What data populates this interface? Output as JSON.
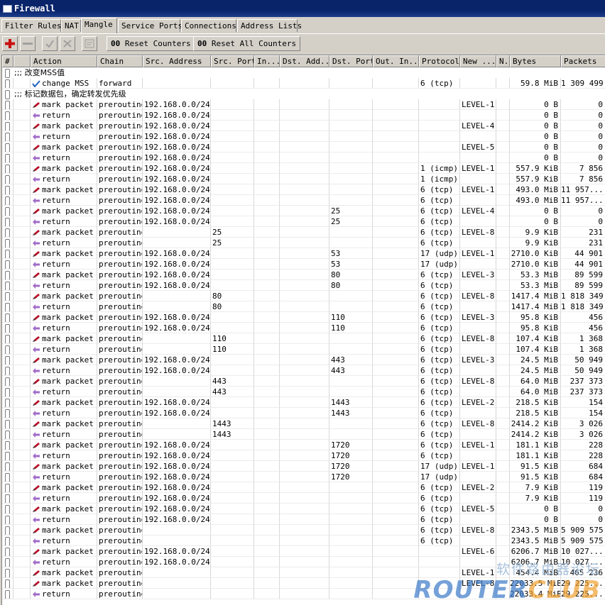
{
  "window": {
    "title": "Firewall"
  },
  "tabs": [
    {
      "label": "Filter Rules",
      "active": false
    },
    {
      "label": "NAT",
      "active": false
    },
    {
      "label": "Mangle",
      "active": true
    },
    {
      "label": "Service Ports",
      "active": false
    },
    {
      "label": "Connections",
      "active": false
    },
    {
      "label": "Address Lists",
      "active": false
    }
  ],
  "toolbar": {
    "reset_counters": "Reset Counters",
    "reset_all_counters": "Reset All Counters",
    "counter_prefix": "00",
    "filter_value": "static",
    "add_icon": "plus-icon",
    "remove_icon": "minus-icon",
    "enable_icon": "check-icon",
    "disable_icon": "x-icon",
    "comment_icon": "note-icon"
  },
  "columns": [
    "#",
    "",
    "Action",
    "Chain",
    "Src. Address",
    "Src. Port",
    "In...",
    "Dst. Add...",
    "Dst. Port",
    "Out. In...",
    "Protocol",
    "New ...",
    "N..",
    "Bytes",
    "Packets"
  ],
  "colors": {
    "selection": "#0a246a",
    "mark_icon": "#b8102a",
    "return_icon": "#a06cc8",
    "check_icon": "#2060c0"
  },
  "rows": [
    {
      "comment": ";;; 改变MSS值"
    },
    {
      "action": "change MSS",
      "icon": "check",
      "chain": "forward",
      "src": "",
      "sport": "",
      "dport": "",
      "proto": "6 (tcp)",
      "mark": "",
      "bytes": "59.8 MiB",
      "packets": "1 309 499"
    },
    {
      "comment": ";;; 标记数据包，确定转发优先级"
    },
    {
      "action": "mark packet",
      "icon": "mark",
      "chain": "prerouting",
      "src": "192.168.0.0/24",
      "sport": "",
      "dport": "",
      "proto": "",
      "mark": "LEVEL-1",
      "bytes": "0 B",
      "packets": "0"
    },
    {
      "action": "return",
      "icon": "return",
      "chain": "prerouting",
      "src": "192.168.0.0/24",
      "sport": "",
      "dport": "",
      "proto": "",
      "mark": "",
      "bytes": "0 B",
      "packets": "0"
    },
    {
      "action": "mark packet",
      "icon": "mark",
      "chain": "prerouting",
      "src": "192.168.0.0/24",
      "sport": "",
      "dport": "",
      "proto": "",
      "mark": "LEVEL-4",
      "bytes": "0 B",
      "packets": "0"
    },
    {
      "action": "return",
      "icon": "return",
      "chain": "prerouting",
      "src": "192.168.0.0/24",
      "sport": "",
      "dport": "",
      "proto": "",
      "mark": "",
      "bytes": "0 B",
      "packets": "0"
    },
    {
      "action": "mark packet",
      "icon": "mark",
      "chain": "prerouting",
      "src": "192.168.0.0/24",
      "sport": "",
      "dport": "",
      "proto": "",
      "mark": "LEVEL-5",
      "bytes": "0 B",
      "packets": "0"
    },
    {
      "action": "return",
      "icon": "return",
      "chain": "prerouting",
      "src": "192.168.0.0/24",
      "sport": "",
      "dport": "",
      "proto": "",
      "mark": "",
      "bytes": "0 B",
      "packets": "0"
    },
    {
      "action": "mark packet",
      "icon": "mark",
      "chain": "prerouting",
      "src": "192.168.0.0/24",
      "sport": "",
      "dport": "",
      "proto": "1 (icmp)",
      "mark": "LEVEL-1",
      "bytes": "557.9 KiB",
      "packets": "7 856"
    },
    {
      "action": "return",
      "icon": "return",
      "chain": "prerouting",
      "src": "192.168.0.0/24",
      "sport": "",
      "dport": "",
      "proto": "1 (icmp)",
      "mark": "",
      "bytes": "557.9 KiB",
      "packets": "7 856"
    },
    {
      "action": "mark packet",
      "icon": "mark",
      "chain": "prerouting",
      "src": "192.168.0.0/24",
      "sport": "",
      "dport": "",
      "proto": "6 (tcp)",
      "mark": "LEVEL-1",
      "bytes": "493.0 MiB",
      "packets": "11 957..."
    },
    {
      "action": "return",
      "icon": "return",
      "chain": "prerouting",
      "src": "192.168.0.0/24",
      "sport": "",
      "dport": "",
      "proto": "6 (tcp)",
      "mark": "",
      "bytes": "493.0 MiB",
      "packets": "11 957..."
    },
    {
      "action": "mark packet",
      "icon": "mark",
      "chain": "prerouting",
      "src": "192.168.0.0/24",
      "sport": "",
      "dport": "25",
      "proto": "6 (tcp)",
      "mark": "LEVEL-4",
      "bytes": "0 B",
      "packets": "0"
    },
    {
      "action": "return",
      "icon": "return",
      "chain": "prerouting",
      "src": "192.168.0.0/24",
      "sport": "",
      "dport": "25",
      "proto": "6 (tcp)",
      "mark": "",
      "bytes": "0 B",
      "packets": "0"
    },
    {
      "action": "mark packet",
      "icon": "mark",
      "chain": "prerouting",
      "src": "",
      "sport": "25",
      "dport": "",
      "proto": "6 (tcp)",
      "mark": "LEVEL-8",
      "bytes": "9.9 KiB",
      "packets": "231"
    },
    {
      "action": "return",
      "icon": "return",
      "chain": "prerouting",
      "src": "",
      "sport": "25",
      "dport": "",
      "proto": "6 (tcp)",
      "mark": "",
      "bytes": "9.9 KiB",
      "packets": "231"
    },
    {
      "action": "mark packet",
      "icon": "mark",
      "chain": "prerouting",
      "src": "192.168.0.0/24",
      "sport": "",
      "dport": "53",
      "proto": "17 (udp)",
      "mark": "LEVEL-1",
      "bytes": "2710.0 KiB",
      "packets": "44 901"
    },
    {
      "action": "return",
      "icon": "return",
      "chain": "prerouting",
      "src": "192.168.0.0/24",
      "sport": "",
      "dport": "53",
      "proto": "17 (udp)",
      "mark": "",
      "bytes": "2710.0 KiB",
      "packets": "44 901"
    },
    {
      "action": "mark packet",
      "icon": "mark",
      "chain": "prerouting",
      "src": "192.168.0.0/24",
      "sport": "",
      "dport": "80",
      "proto": "6 (tcp)",
      "mark": "LEVEL-3",
      "bytes": "53.3 MiB",
      "packets": "89 599"
    },
    {
      "action": "return",
      "icon": "return",
      "chain": "prerouting",
      "src": "192.168.0.0/24",
      "sport": "",
      "dport": "80",
      "proto": "6 (tcp)",
      "mark": "",
      "bytes": "53.3 MiB",
      "packets": "89 599"
    },
    {
      "action": "mark packet",
      "icon": "mark",
      "chain": "prerouting",
      "src": "",
      "sport": "80",
      "dport": "",
      "proto": "6 (tcp)",
      "mark": "LEVEL-8",
      "bytes": "1417.4 MiB",
      "packets": "1 818 349"
    },
    {
      "action": "return",
      "icon": "return",
      "chain": "prerouting",
      "src": "",
      "sport": "80",
      "dport": "",
      "proto": "6 (tcp)",
      "mark": "",
      "bytes": "1417.4 MiB",
      "packets": "1 818 349"
    },
    {
      "action": "mark packet",
      "icon": "mark",
      "chain": "prerouting",
      "src": "192.168.0.0/24",
      "sport": "",
      "dport": "110",
      "proto": "6 (tcp)",
      "mark": "LEVEL-3",
      "bytes": "95.8 KiB",
      "packets": "456"
    },
    {
      "action": "return",
      "icon": "return",
      "chain": "prerouting",
      "src": "192.168.0.0/24",
      "sport": "",
      "dport": "110",
      "proto": "6 (tcp)",
      "mark": "",
      "bytes": "95.8 KiB",
      "packets": "456"
    },
    {
      "action": "mark packet",
      "icon": "mark",
      "chain": "prerouting",
      "src": "",
      "sport": "110",
      "dport": "",
      "proto": "6 (tcp)",
      "mark": "LEVEL-8",
      "bytes": "107.4 KiB",
      "packets": "1 368"
    },
    {
      "action": "return",
      "icon": "return",
      "chain": "prerouting",
      "src": "",
      "sport": "110",
      "dport": "",
      "proto": "6 (tcp)",
      "mark": "",
      "bytes": "107.4 KiB",
      "packets": "1 368"
    },
    {
      "action": "mark packet",
      "icon": "mark",
      "chain": "prerouting",
      "src": "192.168.0.0/24",
      "sport": "",
      "dport": "443",
      "proto": "6 (tcp)",
      "mark": "LEVEL-3",
      "bytes": "24.5 MiB",
      "packets": "50 949"
    },
    {
      "action": "return",
      "icon": "return",
      "chain": "prerouting",
      "src": "192.168.0.0/24",
      "sport": "",
      "dport": "443",
      "proto": "6 (tcp)",
      "mark": "",
      "bytes": "24.5 MiB",
      "packets": "50 949"
    },
    {
      "action": "mark packet",
      "icon": "mark",
      "chain": "prerouting",
      "src": "",
      "sport": "443",
      "dport": "",
      "proto": "6 (tcp)",
      "mark": "LEVEL-8",
      "bytes": "64.0 MiB",
      "packets": "237 373"
    },
    {
      "action": "return",
      "icon": "return",
      "chain": "prerouting",
      "src": "",
      "sport": "443",
      "dport": "",
      "proto": "6 (tcp)",
      "mark": "",
      "bytes": "64.0 MiB",
      "packets": "237 373"
    },
    {
      "action": "mark packet",
      "icon": "mark",
      "chain": "prerouting",
      "src": "192.168.0.0/24",
      "sport": "",
      "dport": "1443",
      "proto": "6 (tcp)",
      "mark": "LEVEL-2",
      "bytes": "218.5 KiB",
      "packets": "154"
    },
    {
      "action": "return",
      "icon": "return",
      "chain": "prerouting",
      "src": "192.168.0.0/24",
      "sport": "",
      "dport": "1443",
      "proto": "6 (tcp)",
      "mark": "",
      "bytes": "218.5 KiB",
      "packets": "154"
    },
    {
      "action": "mark packet",
      "icon": "mark",
      "chain": "prerouting",
      "src": "",
      "sport": "1443",
      "dport": "",
      "proto": "6 (tcp)",
      "mark": "LEVEL-8",
      "bytes": "2414.2 KiB",
      "packets": "3 026"
    },
    {
      "action": "return",
      "icon": "return",
      "chain": "prerouting",
      "src": "",
      "sport": "1443",
      "dport": "",
      "proto": "6 (tcp)",
      "mark": "",
      "bytes": "2414.2 KiB",
      "packets": "3 026"
    },
    {
      "action": "mark packet",
      "icon": "mark",
      "chain": "prerouting",
      "src": "192.168.0.0/24",
      "sport": "",
      "dport": "1720",
      "proto": "6 (tcp)",
      "mark": "LEVEL-1",
      "bytes": "181.1 KiB",
      "packets": "228"
    },
    {
      "action": "return",
      "icon": "return",
      "chain": "prerouting",
      "src": "192.168.0.0/24",
      "sport": "",
      "dport": "1720",
      "proto": "6 (tcp)",
      "mark": "",
      "bytes": "181.1 KiB",
      "packets": "228"
    },
    {
      "action": "mark packet",
      "icon": "mark",
      "chain": "prerouting",
      "src": "192.168.0.0/24",
      "sport": "",
      "dport": "1720",
      "proto": "17 (udp)",
      "mark": "LEVEL-1",
      "bytes": "91.5 KiB",
      "packets": "684"
    },
    {
      "action": "return",
      "icon": "return",
      "chain": "prerouting",
      "src": "192.168.0.0/24",
      "sport": "",
      "dport": "1720",
      "proto": "17 (udp)",
      "mark": "",
      "bytes": "91.5 KiB",
      "packets": "684"
    },
    {
      "action": "mark packet",
      "icon": "mark",
      "chain": "prerouting",
      "src": "192.168.0.0/24",
      "sport": "",
      "dport": "",
      "proto": "6 (tcp)",
      "mark": "LEVEL-2",
      "bytes": "7.9 KiB",
      "packets": "119"
    },
    {
      "action": "return",
      "icon": "return",
      "chain": "prerouting",
      "src": "192.168.0.0/24",
      "sport": "",
      "dport": "",
      "proto": "6 (tcp)",
      "mark": "",
      "bytes": "7.9 KiB",
      "packets": "119"
    },
    {
      "action": "mark packet",
      "icon": "mark",
      "chain": "prerouting",
      "src": "192.168.0.0/24",
      "sport": "",
      "dport": "",
      "proto": "6 (tcp)",
      "mark": "LEVEL-5",
      "bytes": "0 B",
      "packets": "0"
    },
    {
      "action": "return",
      "icon": "return",
      "chain": "prerouting",
      "src": "192.168.0.0/24",
      "sport": "",
      "dport": "",
      "proto": "6 (tcp)",
      "mark": "",
      "bytes": "0 B",
      "packets": "0"
    },
    {
      "action": "mark packet",
      "icon": "mark",
      "chain": "prerouting",
      "src": "",
      "sport": "",
      "dport": "",
      "proto": "6 (tcp)",
      "mark": "LEVEL-8",
      "bytes": "2343.5 MiB",
      "packets": "5 909 575"
    },
    {
      "action": "return",
      "icon": "return",
      "chain": "prerouting",
      "src": "",
      "sport": "",
      "dport": "",
      "proto": "6 (tcp)",
      "mark": "",
      "bytes": "2343.5 MiB",
      "packets": "5 909 575"
    },
    {
      "action": "mark packet",
      "icon": "mark",
      "chain": "prerouting",
      "src": "192.168.0.0/24",
      "sport": "",
      "dport": "",
      "proto": "",
      "mark": "LEVEL-6",
      "bytes": "6206.7 MiB",
      "packets": "10 027..."
    },
    {
      "action": "return",
      "icon": "return",
      "chain": "prerouting",
      "src": "192.168.0.0/24",
      "sport": "",
      "dport": "",
      "proto": "",
      "mark": "",
      "bytes": "6206.7 MiB",
      "packets": "10 027..."
    },
    {
      "action": "mark packet",
      "icon": "mark",
      "chain": "prerouting",
      "src": "",
      "sport": "",
      "dport": "",
      "proto": "",
      "mark": "LEVEL-1",
      "bytes": "454.4 MiB",
      "packets": "465 236"
    },
    {
      "action": "mark packet",
      "icon": "mark",
      "chain": "prerouting",
      "src": "",
      "sport": "",
      "dport": "",
      "proto": "",
      "mark": "LEVEL-8",
      "bytes": "22033.5 MiB",
      "packets": "29 225..."
    },
    {
      "action": "return",
      "icon": "return",
      "chain": "prerouting",
      "src": "",
      "sport": "",
      "dport": "",
      "proto": "",
      "mark": "",
      "bytes": "22033.4 MiB",
      "packets": "29 225..."
    }
  ],
  "watermark": {
    "line1": "软件路由器论坛",
    "line2a": "ROUTER",
    "line2b": "CLUB"
  }
}
